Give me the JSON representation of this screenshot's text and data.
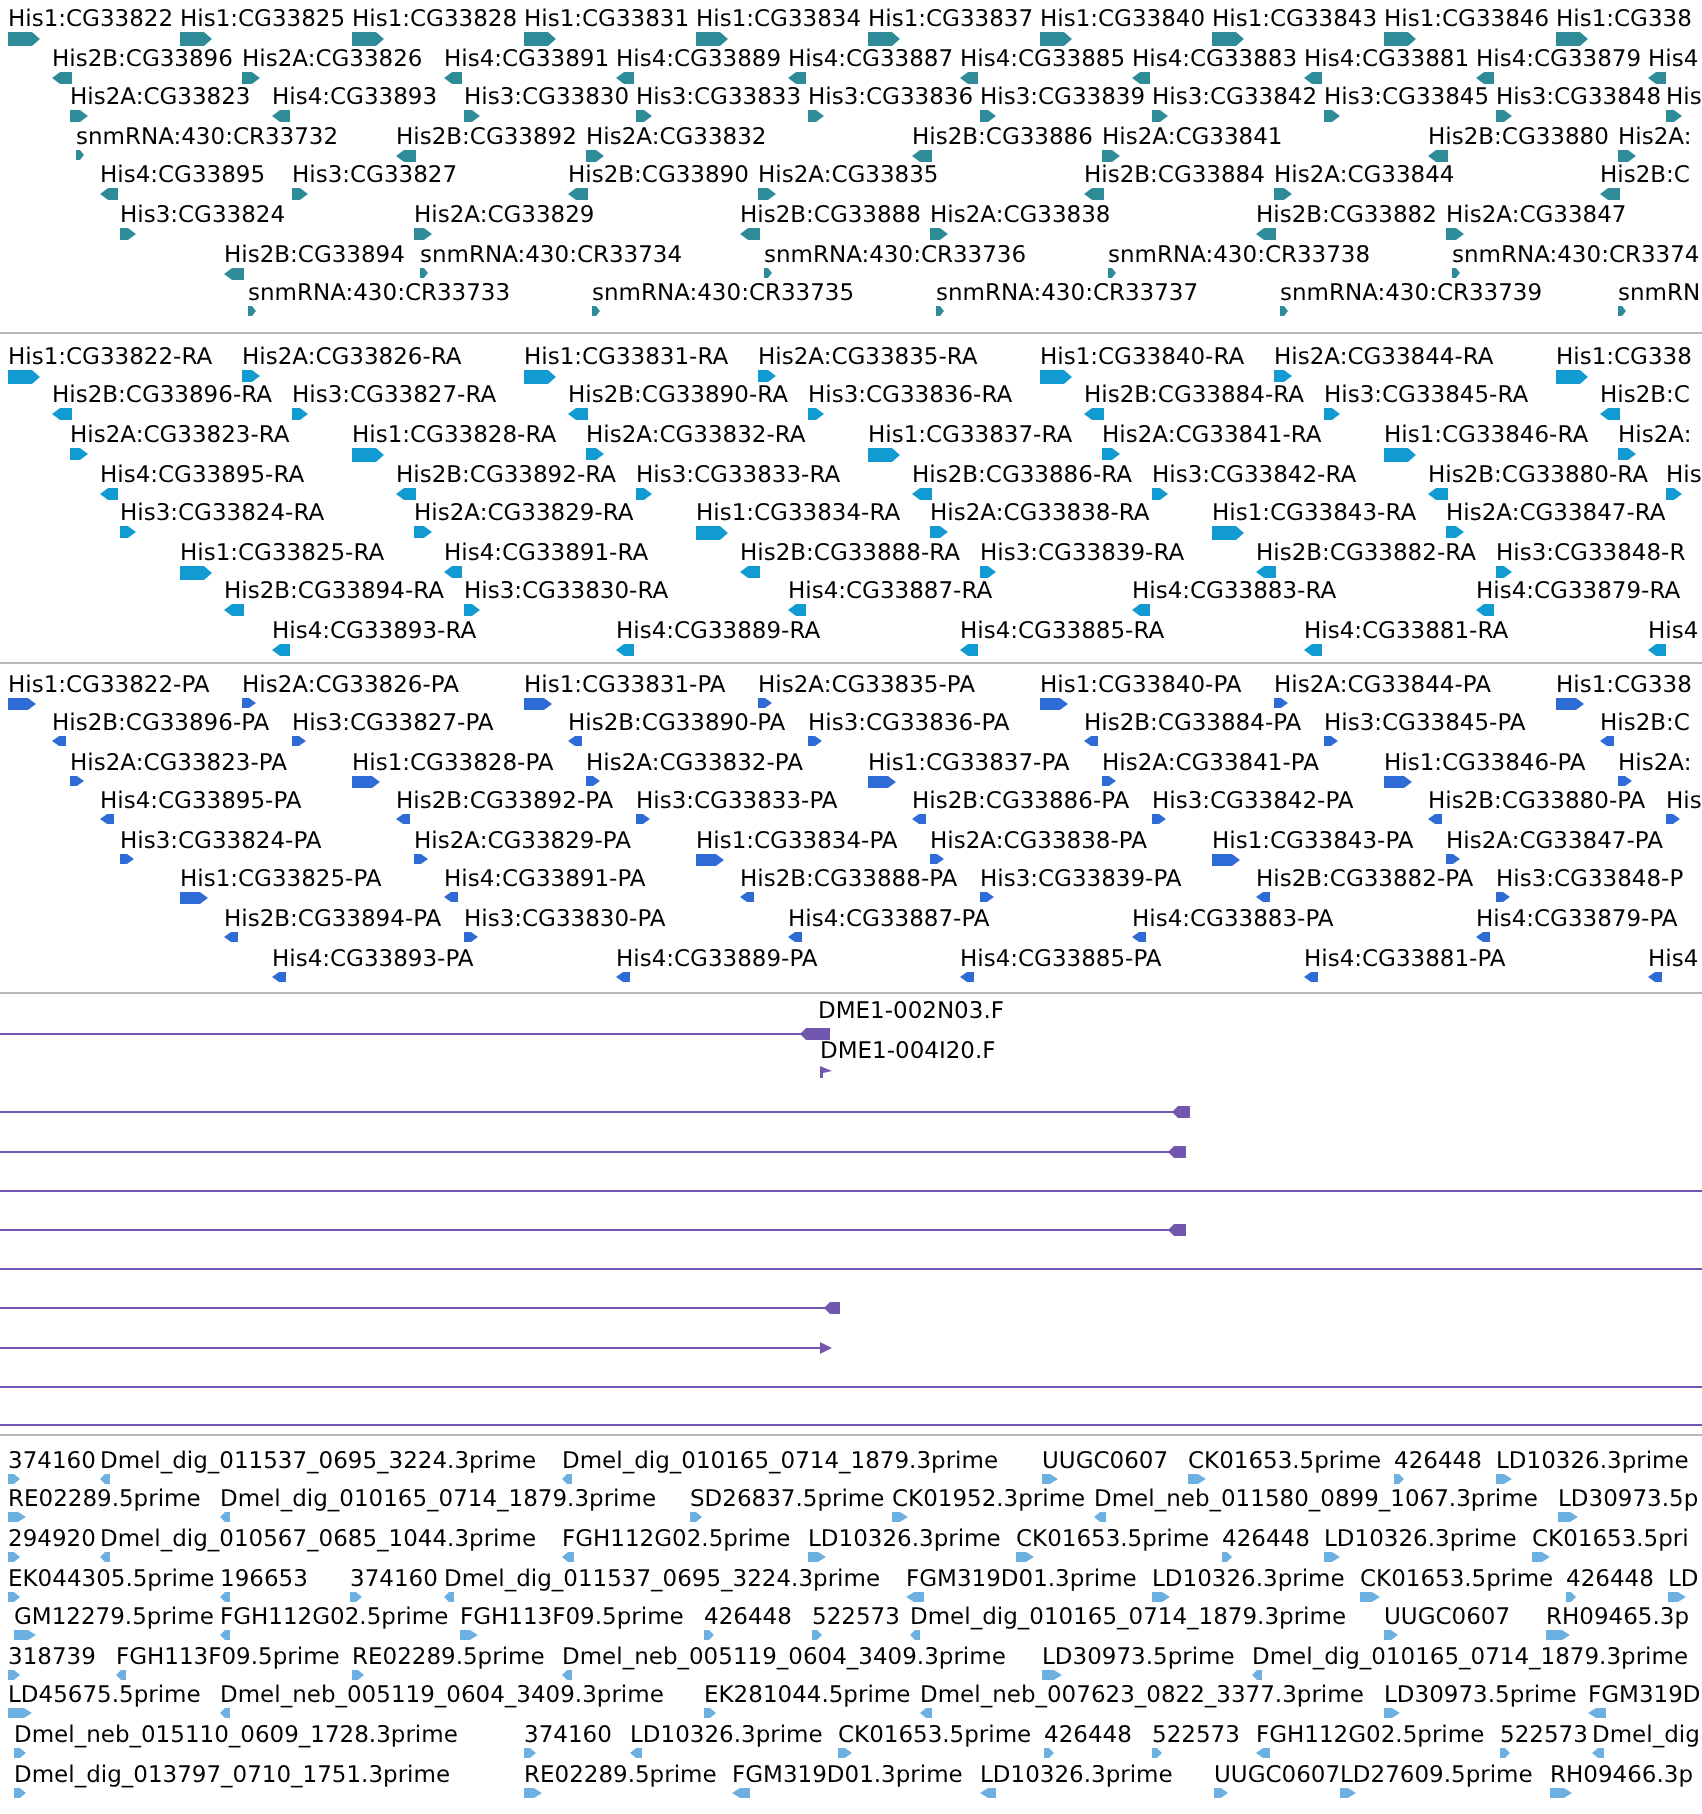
{
  "tracks": [
    {
      "kind": "feature",
      "color": "#2e8b98",
      "rows": [
        [
          {
            "label": "His1:CG33822",
            "reverse": false
          },
          {
            "label": "His1:CG33825",
            "reverse": false
          },
          {
            "label": "His1:CG33828",
            "reverse": false
          },
          {
            "label": "His1:CG33831",
            "reverse": false
          },
          {
            "label": "His1:CG33834",
            "reverse": false
          },
          {
            "label": "His1:CG33837",
            "reverse": false
          },
          {
            "label": "His1:CG33840",
            "reverse": false
          },
          {
            "label": "His1:CG33843",
            "reverse": false
          },
          {
            "label": "His1:CG33846",
            "reverse": false
          },
          {
            "label": "His1:CG338",
            "reverse": false
          }
        ],
        [
          {
            "label": "His2B:CG33896",
            "reverse": true
          },
          {
            "label": "His2A:CG33826",
            "reverse": false
          },
          {
            "label": "His4:CG33891",
            "reverse": true
          },
          {
            "label": "His4:CG33889",
            "reverse": true
          },
          {
            "label": "His4:CG33887",
            "reverse": true
          },
          {
            "label": "His4:CG33885",
            "reverse": true
          },
          {
            "label": "His4:CG33883",
            "reverse": true
          },
          {
            "label": "His4:CG33881",
            "reverse": true
          },
          {
            "label": "His4:CG33879",
            "reverse": true
          },
          {
            "label": "His4",
            "reverse": true
          }
        ],
        [
          {
            "label": "His2A:CG33823",
            "reverse": false
          },
          {
            "label": "His4:CG33893",
            "reverse": true
          },
          {
            "label": "His3:CG33830",
            "reverse": false
          },
          {
            "label": "His3:CG33833",
            "reverse": false
          },
          {
            "label": "His3:CG33836",
            "reverse": false
          },
          {
            "label": "His3:CG33839",
            "reverse": false
          },
          {
            "label": "His3:CG33842",
            "reverse": false
          },
          {
            "label": "His3:CG33845",
            "reverse": false
          },
          {
            "label": "His3:CG33848",
            "reverse": false
          },
          {
            "label": "His",
            "reverse": false
          }
        ],
        [
          {
            "label": "snmRNA:430:CR33732",
            "reverse": false
          },
          {
            "label": "His2B:CG33892",
            "reverse": true
          },
          {
            "label": "His2A:CG33832",
            "reverse": false
          },
          {
            "label": "His2B:CG33886",
            "reverse": true
          },
          {
            "label": "His2A:CG33841",
            "reverse": false
          },
          {
            "label": "His2B:CG33880",
            "reverse": true
          },
          {
            "label": "His2A:",
            "reverse": false
          }
        ],
        [
          {
            "label": "His4:CG33895",
            "reverse": true
          },
          {
            "label": "His3:CG33827",
            "reverse": false
          },
          {
            "label": "His2B:CG33890",
            "reverse": true
          },
          {
            "label": "His2A:CG33835",
            "reverse": false
          },
          {
            "label": "His2B:CG33884",
            "reverse": true
          },
          {
            "label": "His2A:CG33844",
            "reverse": false
          },
          {
            "label": "His2B:C",
            "reverse": true
          }
        ],
        [
          {
            "label": "His3:CG33824",
            "reverse": false
          },
          {
            "label": "His2A:CG33829",
            "reverse": false
          },
          {
            "label": "His2B:CG33888",
            "reverse": true
          },
          {
            "label": "His2A:CG33838",
            "reverse": false
          },
          {
            "label": "His2B:CG33882",
            "reverse": true
          },
          {
            "label": "His2A:CG33847",
            "reverse": false
          }
        ],
        [
          {
            "label": "His2B:CG33894",
            "reverse": true
          },
          {
            "label": "snmRNA:430:CR33734",
            "reverse": false
          },
          {
            "label": "snmRNA:430:CR33736",
            "reverse": false
          },
          {
            "label": "snmRNA:430:CR33738",
            "reverse": false
          },
          {
            "label": "snmRNA:430:CR3374",
            "reverse": false
          }
        ],
        [
          {
            "label": "snmRNA:430:CR33733",
            "reverse": false
          },
          {
            "label": "snmRNA:430:CR33735",
            "reverse": false
          },
          {
            "label": "snmRNA:430:CR33737",
            "reverse": false
          },
          {
            "label": "snmRNA:430:CR33739",
            "reverse": false
          },
          {
            "label": "snmRN",
            "reverse": false
          }
        ]
      ]
    },
    {
      "kind": "feature",
      "color": "#129bd2",
      "rows": [
        [
          {
            "label": "His1:CG33822-RA",
            "reverse": false
          },
          {
            "label": "His2A:CG33826-RA",
            "reverse": false
          },
          {
            "label": "His1:CG33831-RA",
            "reverse": false
          },
          {
            "label": "His2A:CG33835-RA",
            "reverse": false
          },
          {
            "label": "His1:CG33840-RA",
            "reverse": false
          },
          {
            "label": "His2A:CG33844-RA",
            "reverse": false
          },
          {
            "label": "His1:CG338",
            "reverse": false
          }
        ],
        [
          {
            "label": "His2B:CG33896-RA",
            "reverse": true
          },
          {
            "label": "His3:CG33827-RA",
            "reverse": false
          },
          {
            "label": "His2B:CG33890-RA",
            "reverse": true
          },
          {
            "label": "His3:CG33836-RA",
            "reverse": false
          },
          {
            "label": "His2B:CG33884-RA",
            "reverse": true
          },
          {
            "label": "His3:CG33845-RA",
            "reverse": false
          },
          {
            "label": "His2B:C",
            "reverse": true
          }
        ],
        [
          {
            "label": "His2A:CG33823-RA",
            "reverse": false
          },
          {
            "label": "His1:CG33828-RA",
            "reverse": false
          },
          {
            "label": "His2A:CG33832-RA",
            "reverse": false
          },
          {
            "label": "His1:CG33837-RA",
            "reverse": false
          },
          {
            "label": "His2A:CG33841-RA",
            "reverse": false
          },
          {
            "label": "His1:CG33846-RA",
            "reverse": false
          },
          {
            "label": "His2A:",
            "reverse": false
          }
        ],
        [
          {
            "label": "His4:CG33895-RA",
            "reverse": true
          },
          {
            "label": "His2B:CG33892-RA",
            "reverse": true
          },
          {
            "label": "His3:CG33833-RA",
            "reverse": false
          },
          {
            "label": "His2B:CG33886-RA",
            "reverse": true
          },
          {
            "label": "His3:CG33842-RA",
            "reverse": false
          },
          {
            "label": "His2B:CG33880-RA",
            "reverse": true
          },
          {
            "label": "His",
            "reverse": false
          }
        ],
        [
          {
            "label": "His3:CG33824-RA",
            "reverse": false
          },
          {
            "label": "His2A:CG33829-RA",
            "reverse": false
          },
          {
            "label": "His1:CG33834-RA",
            "reverse": false
          },
          {
            "label": "His2A:CG33838-RA",
            "reverse": false
          },
          {
            "label": "His1:CG33843-RA",
            "reverse": false
          },
          {
            "label": "His2A:CG33847-RA",
            "reverse": false
          }
        ],
        [
          {
            "label": "His1:CG33825-RA",
            "reverse": false
          },
          {
            "label": "His4:CG33891-RA",
            "reverse": true
          },
          {
            "label": "His2B:CG33888-RA",
            "reverse": true
          },
          {
            "label": "His3:CG33839-RA",
            "reverse": false
          },
          {
            "label": "His2B:CG33882-RA",
            "reverse": true
          },
          {
            "label": "His3:CG33848-R",
            "reverse": false
          }
        ],
        [
          {
            "label": "His2B:CG33894-RA",
            "reverse": true
          },
          {
            "label": "His3:CG33830-RA",
            "reverse": false
          },
          {
            "label": "His4:CG33887-RA",
            "reverse": true
          },
          {
            "label": "His4:CG33883-RA",
            "reverse": true
          },
          {
            "label": "His4:CG33879-RA",
            "reverse": true
          }
        ],
        [
          {
            "label": "His4:CG33893-RA",
            "reverse": true
          },
          {
            "label": "His4:CG33889-RA",
            "reverse": true
          },
          {
            "label": "His4:CG33885-RA",
            "reverse": true
          },
          {
            "label": "His4:CG33881-RA",
            "reverse": true
          },
          {
            "label": "His4",
            "reverse": true
          }
        ]
      ]
    },
    {
      "kind": "feature",
      "color": "#2f6bd6",
      "rows": [
        [
          {
            "label": "His1:CG33822-PA",
            "reverse": false
          },
          {
            "label": "His2A:CG33826-PA",
            "reverse": false
          },
          {
            "label": "His1:CG33831-PA",
            "reverse": false
          },
          {
            "label": "His2A:CG33835-PA",
            "reverse": false
          },
          {
            "label": "His1:CG33840-PA",
            "reverse": false
          },
          {
            "label": "His2A:CG33844-PA",
            "reverse": false
          },
          {
            "label": "His1:CG338",
            "reverse": false
          }
        ],
        [
          {
            "label": "His2B:CG33896-PA",
            "reverse": true
          },
          {
            "label": "His3:CG33827-PA",
            "reverse": false
          },
          {
            "label": "His2B:CG33890-PA",
            "reverse": true
          },
          {
            "label": "His3:CG33836-PA",
            "reverse": false
          },
          {
            "label": "His2B:CG33884-PA",
            "reverse": true
          },
          {
            "label": "His3:CG33845-PA",
            "reverse": false
          },
          {
            "label": "His2B:C",
            "reverse": true
          }
        ],
        [
          {
            "label": "His2A:CG33823-PA",
            "reverse": false
          },
          {
            "label": "His1:CG33828-PA",
            "reverse": false
          },
          {
            "label": "His2A:CG33832-PA",
            "reverse": false
          },
          {
            "label": "His1:CG33837-PA",
            "reverse": false
          },
          {
            "label": "His2A:CG33841-PA",
            "reverse": false
          },
          {
            "label": "His1:CG33846-PA",
            "reverse": false
          },
          {
            "label": "His2A:",
            "reverse": false
          }
        ],
        [
          {
            "label": "His4:CG33895-PA",
            "reverse": true
          },
          {
            "label": "His2B:CG33892-PA",
            "reverse": true
          },
          {
            "label": "His3:CG33833-PA",
            "reverse": false
          },
          {
            "label": "His2B:CG33886-PA",
            "reverse": true
          },
          {
            "label": "His3:CG33842-PA",
            "reverse": false
          },
          {
            "label": "His2B:CG33880-PA",
            "reverse": true
          },
          {
            "label": "His",
            "reverse": false
          }
        ],
        [
          {
            "label": "His3:CG33824-PA",
            "reverse": false
          },
          {
            "label": "His2A:CG33829-PA",
            "reverse": false
          },
          {
            "label": "His1:CG33834-PA",
            "reverse": false
          },
          {
            "label": "His2A:CG33838-PA",
            "reverse": false
          },
          {
            "label": "His1:CG33843-PA",
            "reverse": false
          },
          {
            "label": "His2A:CG33847-PA",
            "reverse": false
          }
        ],
        [
          {
            "label": "His1:CG33825-PA",
            "reverse": false
          },
          {
            "label": "His4:CG33891-PA",
            "reverse": true
          },
          {
            "label": "His2B:CG33888-PA",
            "reverse": true
          },
          {
            "label": "His3:CG33839-PA",
            "reverse": false
          },
          {
            "label": "His2B:CG33882-PA",
            "reverse": true
          },
          {
            "label": "His3:CG33848-P",
            "reverse": false
          }
        ],
        [
          {
            "label": "His2B:CG33894-PA",
            "reverse": true
          },
          {
            "label": "His3:CG33830-PA",
            "reverse": false
          },
          {
            "label": "His4:CG33887-PA",
            "reverse": true
          },
          {
            "label": "His4:CG33883-PA",
            "reverse": true
          },
          {
            "label": "His4:CG33879-PA",
            "reverse": true
          }
        ],
        [
          {
            "label": "His4:CG33893-PA",
            "reverse": true
          },
          {
            "label": "His4:CG33889-PA",
            "reverse": true
          },
          {
            "label": "His4:CG33885-PA",
            "reverse": true
          },
          {
            "label": "His4:CG33881-PA",
            "reverse": true
          },
          {
            "label": "His4",
            "reverse": true
          }
        ]
      ]
    },
    {
      "kind": "alignment",
      "color": "#7356ad",
      "rows": [
        {
          "kind": "block",
          "label": "DME1-002N03.F"
        },
        {
          "kind": "flag",
          "label": "DME1-004I20.F"
        },
        {
          "kind": "block"
        },
        {
          "kind": "block"
        },
        {
          "kind": "line"
        },
        {
          "kind": "block"
        },
        {
          "kind": "line"
        },
        {
          "kind": "block"
        },
        {
          "kind": "arrow"
        },
        {
          "kind": "line"
        },
        {
          "kind": "line"
        }
      ]
    },
    {
      "kind": "feature",
      "color": "#6cb0e2",
      "rows": [
        [
          {
            "label": "374160",
            "reverse": false
          },
          {
            "label": "Dmel_dig_011537_0695_3224.3prime",
            "reverse": true
          },
          {
            "label": "Dmel_dig_010165_0714_1879.3prime",
            "reverse": true
          },
          {
            "label": "UUGC0607",
            "reverse": false
          },
          {
            "label": "CK01653.5prime",
            "reverse": false
          },
          {
            "label": "426448",
            "reverse": false
          },
          {
            "label": "LD10326.3prime",
            "reverse": false
          }
        ],
        [
          {
            "label": "RE02289.5prime",
            "reverse": false
          },
          {
            "label": "Dmel_dig_010165_0714_1879.3prime",
            "reverse": true
          },
          {
            "label": "SD26837.5prime",
            "reverse": false
          },
          {
            "label": "CK01952.3prime",
            "reverse": false
          },
          {
            "label": "Dmel_neb_011580_0899_1067.3prime",
            "reverse": true
          },
          {
            "label": "LD30973.5p",
            "reverse": false
          }
        ],
        [
          {
            "label": "294920",
            "reverse": false
          },
          {
            "label": "Dmel_dig_010567_0685_1044.3prime",
            "reverse": true
          },
          {
            "label": "FGH112G02.5prime",
            "reverse": true
          },
          {
            "label": "LD10326.3prime",
            "reverse": false
          },
          {
            "label": "CK01653.5prime",
            "reverse": false
          },
          {
            "label": "426448",
            "reverse": false
          },
          {
            "label": "LD10326.3prime",
            "reverse": false
          },
          {
            "label": "CK01653.5pri",
            "reverse": false
          }
        ],
        [
          {
            "label": "EK044305.5prime",
            "reverse": false
          },
          {
            "label": "196653",
            "reverse": true
          },
          {
            "label": "374160",
            "reverse": false
          },
          {
            "label": "Dmel_dig_011537_0695_3224.3prime",
            "reverse": true
          },
          {
            "label": "FGM319D01.3prime",
            "reverse": true
          },
          {
            "label": "LD10326.3prime",
            "reverse": false
          },
          {
            "label": "CK01653.5prime",
            "reverse": false
          },
          {
            "label": "426448",
            "reverse": false
          },
          {
            "label": "LD",
            "reverse": false
          }
        ],
        [
          {
            "label": "GM12279.5prime",
            "reverse": false
          },
          {
            "label": "FGH112G02.5prime",
            "reverse": true
          },
          {
            "label": "FGH113F09.5prime",
            "reverse": false
          },
          {
            "label": "426448",
            "reverse": false
          },
          {
            "label": "522573",
            "reverse": false
          },
          {
            "label": "Dmel_dig_010165_0714_1879.3prime",
            "reverse": true
          },
          {
            "label": "UUGC0607",
            "reverse": false
          },
          {
            "label": "RH09465.3p",
            "reverse": false
          }
        ],
        [
          {
            "label": "318739",
            "reverse": false
          },
          {
            "label": "FGH113F09.5prime",
            "reverse": true
          },
          {
            "label": "RE02289.5prime",
            "reverse": false
          },
          {
            "label": "Dmel_neb_005119_0604_3409.3prime",
            "reverse": true
          },
          {
            "label": "LD30973.5prime",
            "reverse": false
          },
          {
            "label": "Dmel_dig_010165_0714_1879.3prime",
            "reverse": true
          }
        ],
        [
          {
            "label": "LD45675.5prime",
            "reverse": false
          },
          {
            "label": "Dmel_neb_005119_0604_3409.3prime",
            "reverse": true
          },
          {
            "label": "EK281044.5prime",
            "reverse": false
          },
          {
            "label": "Dmel_neb_007623_0822_3377.3prime",
            "reverse": true
          },
          {
            "label": "LD30973.5prime",
            "reverse": false
          },
          {
            "label": "FGM319D",
            "reverse": true
          }
        ],
        [
          {
            "label": "Dmel_neb_015110_0609_1728.3prime",
            "reverse": false
          },
          {
            "label": "374160",
            "reverse": false
          },
          {
            "label": "LD10326.3prime",
            "reverse": true
          },
          {
            "label": "CK01653.5prime",
            "reverse": false
          },
          {
            "label": "426448",
            "reverse": false
          },
          {
            "label": "522573",
            "reverse": false
          },
          {
            "label": "FGH112G02.5prime",
            "reverse": true
          },
          {
            "label": "522573",
            "reverse": false
          },
          {
            "label": "Dmel_dig",
            "reverse": true
          }
        ],
        [
          {
            "label": "Dmel_dig_013797_0710_1751.3prime",
            "reverse": false
          },
          {
            "label": "RE02289.5prime",
            "reverse": false
          },
          {
            "label": "FGM319D01.3prime",
            "reverse": true
          },
          {
            "label": "LD10326.3prime",
            "reverse": true
          },
          {
            "label": "UUGC0607",
            "reverse": false
          },
          {
            "label": "LD27609.5prime",
            "reverse": false
          },
          {
            "label": "RH09466.3p",
            "reverse": false
          }
        ]
      ]
    }
  ]
}
